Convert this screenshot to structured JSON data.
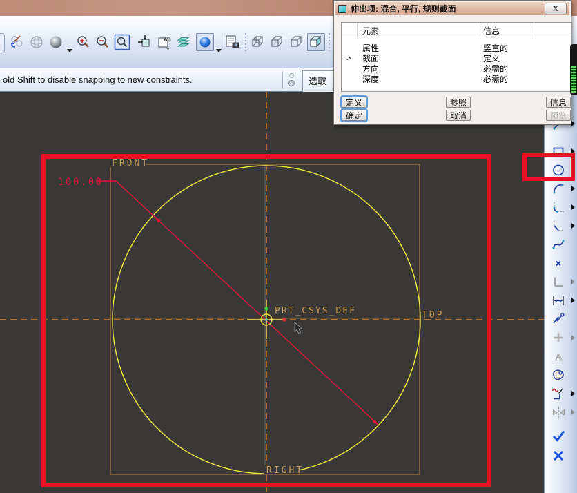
{
  "top_toolbar": {
    "saved_views_label": "AB",
    "icons": [
      "repaint",
      "wireframe-display",
      "shaded-display",
      "zoom-in",
      "zoom-out",
      "zoom-fit",
      "reorient-view",
      "saved-view-list",
      "layers",
      "datum-display",
      "model-tree",
      "wireframe-mode",
      "hidden-line-mode",
      "no-hidden-mode",
      "shading-mode",
      "datum-plane-toggle"
    ]
  },
  "message_bar": {
    "text": "old Shift to disable snapping to new constraints.",
    "select_label": "选取"
  },
  "dialog": {
    "title": "伸出项: 混合, 平行, 规则截面",
    "table": {
      "col_element": "元素",
      "col_info": "信息",
      "selected_marker": ">",
      "rows": [
        {
          "element": "属性",
          "info": "竖直的"
        },
        {
          "element": "截面",
          "info": "定义"
        },
        {
          "element": "方向",
          "info": "必需的"
        },
        {
          "element": "深度",
          "info": "必需的"
        }
      ]
    },
    "buttons": {
      "define": "定义",
      "references": "参照",
      "info": "信息",
      "ok": "确定",
      "cancel": "取消",
      "preview": "预览"
    }
  },
  "sketch": {
    "dimension_value": "100.00",
    "label_front": "FRONT",
    "label_top": "TOP",
    "label_right": "RIGHT",
    "label_csys": "PRT_CSYS_DEF",
    "colors": {
      "background": "#3a3937",
      "circle": "#e8e23c",
      "datum": "#a57a42",
      "centerline": "#e2861e",
      "dimension": "#dc1438",
      "annotation": "#e81123"
    }
  },
  "right_toolbar": {
    "text_tool_label": "A",
    "items": [
      "line",
      "rectangle",
      "circle",
      "arc",
      "fillet",
      "chamfer",
      "spline",
      "point",
      "coordinate-system",
      "dimension",
      "modify",
      "constraint",
      "text",
      "palette",
      "trim",
      "mirror",
      "done",
      "quit"
    ]
  }
}
